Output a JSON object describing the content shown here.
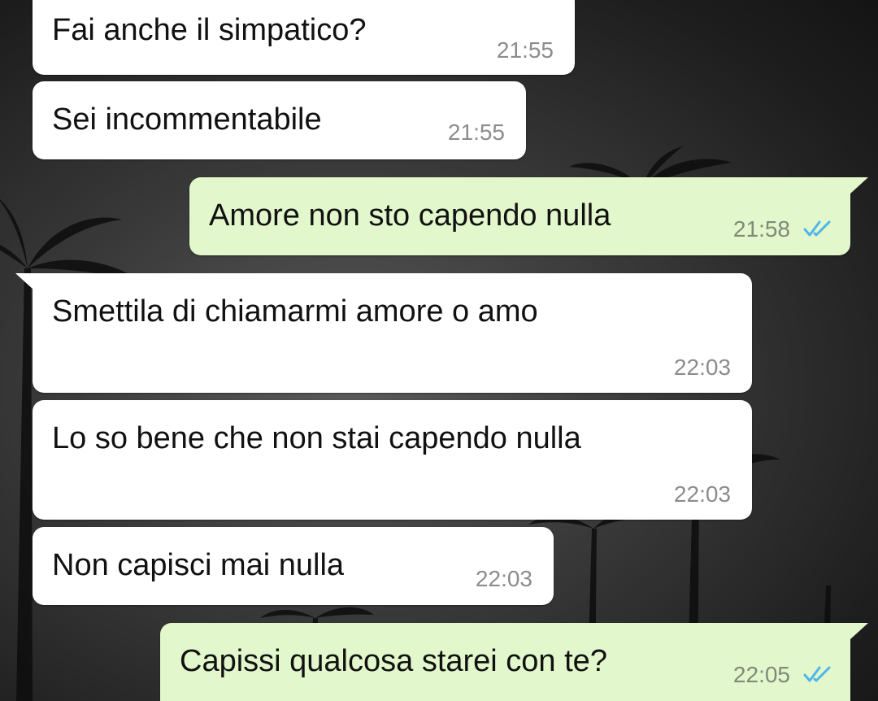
{
  "chat": {
    "messages": [
      {
        "direction": "incoming",
        "text": "Fai anche il simpatico?",
        "time": "21:55"
      },
      {
        "direction": "incoming",
        "text": "Sei incommentabile",
        "time": "21:55"
      },
      {
        "direction": "outgoing",
        "text": "Amore non sto capendo nulla",
        "time": "21:58",
        "status": "read"
      },
      {
        "direction": "incoming",
        "text": "Smettila di chiamarmi amore o amo",
        "time": "22:03"
      },
      {
        "direction": "incoming",
        "text": "Lo so bene che non stai capendo nulla",
        "time": "22:03"
      },
      {
        "direction": "incoming",
        "text": "Non capisci mai nulla",
        "time": "22:03"
      },
      {
        "direction": "outgoing",
        "text": "Capissi qualcosa starei con te?",
        "time": "22:05",
        "status": "read"
      }
    ]
  },
  "colors": {
    "incoming_bubble": "#ffffff",
    "outgoing_bubble": "#e2f7cb",
    "read_ticks": "#4fb6ec"
  },
  "icons": {
    "read_status": "double-check-icon",
    "wallpaper": "palm-trees-wallpaper"
  }
}
